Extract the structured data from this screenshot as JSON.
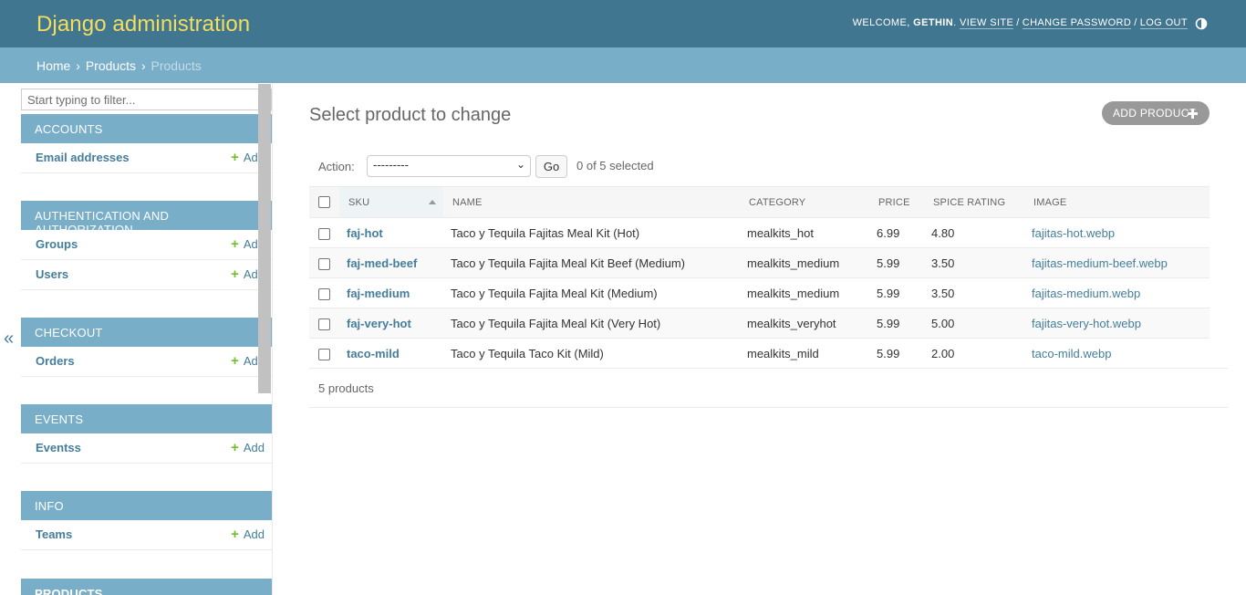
{
  "header": {
    "title": "Django administration",
    "welcome": "WELCOME,",
    "username": "GETHIN",
    "view_site": "VIEW SITE",
    "change_password": "CHANGE PASSWORD",
    "log_out": "LOG OUT",
    "theme_icon": "half-circle-icon"
  },
  "breadcrumbs": {
    "home": "Home",
    "app": "Products",
    "current": "Products"
  },
  "sidebar": {
    "filter_placeholder": "Start typing to filter...",
    "collapse_symbol": "«",
    "add_label": "Add",
    "modules": [
      {
        "caption": "ACCOUNTS",
        "models": [
          "Email addresses"
        ]
      },
      {
        "caption": "AUTHENTICATION AND AUTHORIZATION",
        "models": [
          "Groups",
          "Users"
        ]
      },
      {
        "caption": "CHECKOUT",
        "models": [
          "Orders"
        ]
      },
      {
        "caption": "EVENTS",
        "models": [
          "Eventss"
        ]
      },
      {
        "caption": "INFO",
        "models": [
          "Teams"
        ]
      },
      {
        "caption": "PRODUCTS",
        "models": []
      }
    ]
  },
  "content": {
    "title": "Select product to change",
    "add_button": "ADD PRODUCT",
    "action_label": "Action:",
    "action_selected": "---------",
    "go_label": "Go",
    "selected_count": "0 of 5 selected",
    "columns": [
      "SKU",
      "NAME",
      "CATEGORY",
      "PRICE",
      "SPICE RATING",
      "IMAGE"
    ],
    "rows": [
      {
        "sku": "faj-hot",
        "name": "Taco y Tequila Fajitas Meal Kit (Hot)",
        "category": "mealkits_hot",
        "price": "6.99",
        "spice": "4.80",
        "image": "fajitas-hot.webp"
      },
      {
        "sku": "faj-med-beef",
        "name": "Taco y Tequila Fajita Meal Kit Beef (Medium)",
        "category": "mealkits_medium",
        "price": "5.99",
        "spice": "3.50",
        "image": "fajitas-medium-beef.webp"
      },
      {
        "sku": "faj-medium",
        "name": "Taco y Tequila Fajita Meal Kit (Medium)",
        "category": "mealkits_medium",
        "price": "5.99",
        "spice": "3.50",
        "image": "fajitas-medium.webp"
      },
      {
        "sku": "faj-very-hot",
        "name": "Taco y Tequila Fajita Meal Kit (Very Hot)",
        "category": "mealkits_veryhot",
        "price": "5.99",
        "spice": "5.00",
        "image": "fajitas-very-hot.webp"
      },
      {
        "sku": "taco-mild",
        "name": "Taco y Tequila Taco Kit (Mild)",
        "category": "mealkits_mild",
        "price": "5.99",
        "spice": "2.00",
        "image": "taco-mild.webp"
      }
    ],
    "paginator": "5 products"
  }
}
